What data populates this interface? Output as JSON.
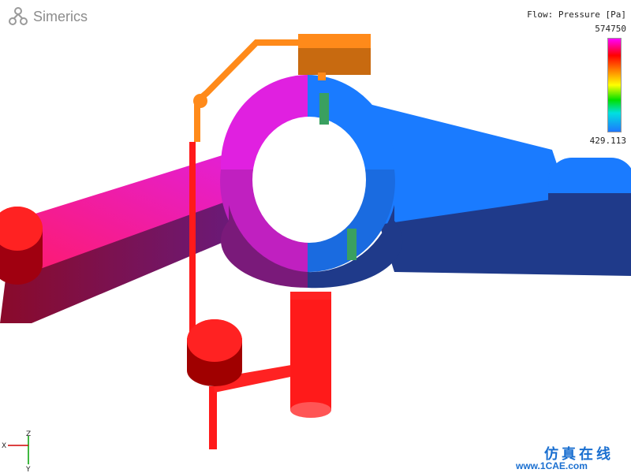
{
  "brand": {
    "name": "Simerics"
  },
  "legend": {
    "title": "Flow: Pressure [Pa]",
    "max": "574750",
    "min": "429.113",
    "colors": [
      "#ff00ff",
      "#ff0000",
      "#ff8800",
      "#ffff00",
      "#00e000",
      "#00e0e0",
      "#1e78ff"
    ]
  },
  "axes": {
    "x": "X",
    "y": "Y",
    "z": "Z"
  },
  "watermark": {
    "text": "仿真在线",
    "url": "www.1CAE.com"
  },
  "scene": {
    "colors": {
      "magenta": "#e020e0",
      "magenta_dark": "#8a1f8a",
      "blue": "#1a7bff",
      "blue_dark": "#1f3a8a",
      "red": "#ff1a1a",
      "red_dark": "#a00000",
      "orange": "#ff8a1a",
      "orange_dark": "#b85a00"
    }
  }
}
